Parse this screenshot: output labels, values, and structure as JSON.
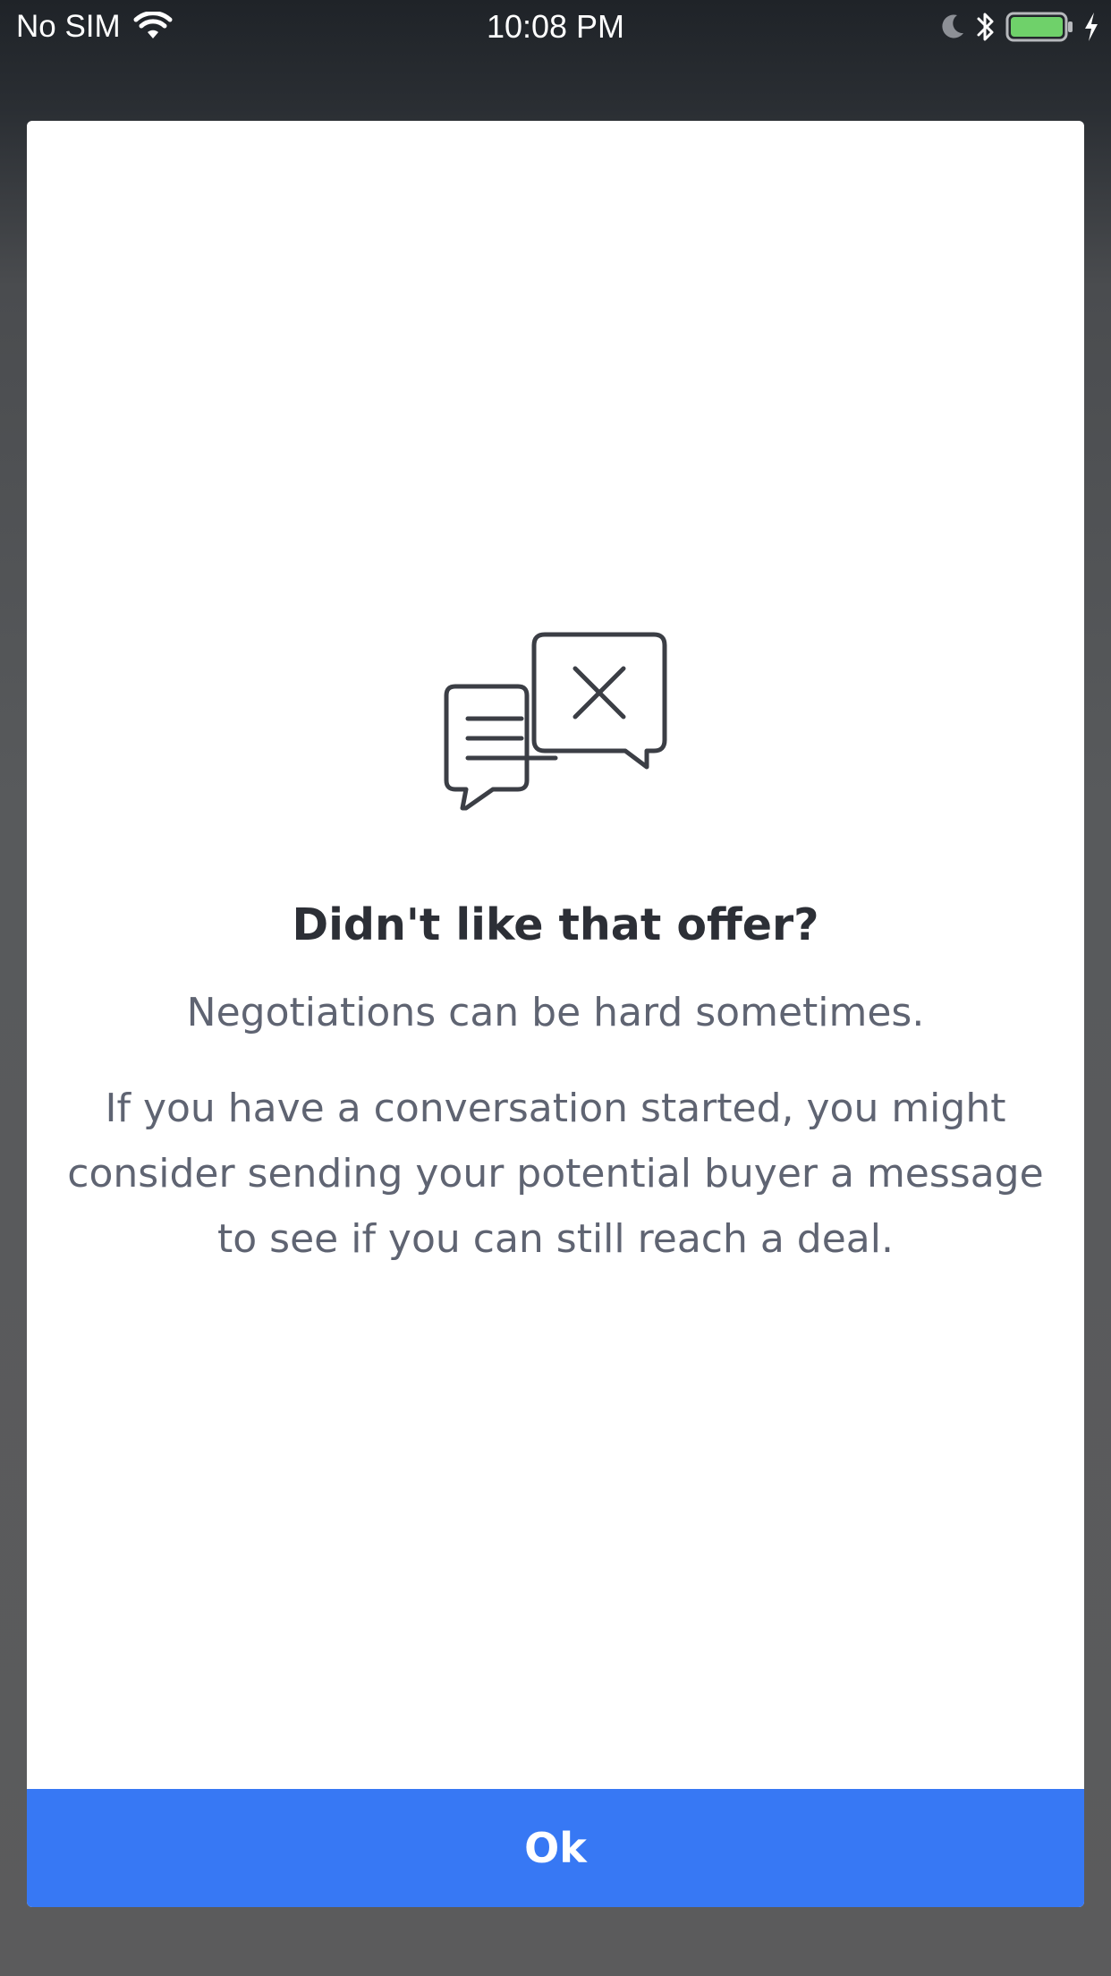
{
  "status_bar": {
    "carrier": "No SIM",
    "time": "10:08 PM",
    "icons": [
      "wifi-icon",
      "moon-icon",
      "bluetooth-icon",
      "battery-icon",
      "charging-bolt-icon"
    ],
    "battery_fill_color": "#6fd16a"
  },
  "modal": {
    "illustration": "declined-chat-bubbles-icon",
    "title": "Didn't like that offer?",
    "subtitle": "Negotiations can be hard sometimes.",
    "body": "If you have a conversation started, you might consider sending your potential buyer a message to see if you can still reach a deal.",
    "ok_label": "Ok"
  },
  "colors": {
    "accent": "#3778f4",
    "title_text": "#2c2f36",
    "body_text": "#5f6472"
  }
}
